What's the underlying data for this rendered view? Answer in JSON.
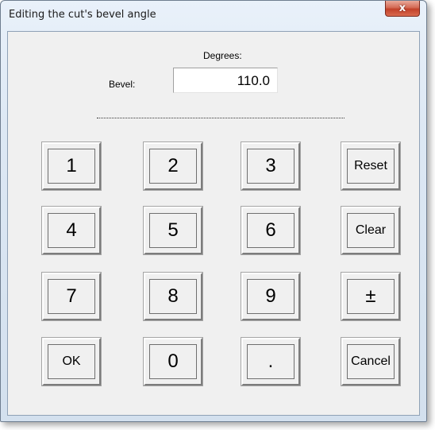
{
  "window": {
    "title": "Editing the cut's bevel angle",
    "close_glyph": "x"
  },
  "field": {
    "unit_label": "Degrees:",
    "label": "Bevel:",
    "value": "110.0"
  },
  "keys": {
    "k1": "1",
    "k2": "2",
    "k3": "3",
    "reset": "Reset",
    "k4": "4",
    "k5": "5",
    "k6": "6",
    "clear": "Clear",
    "k7": "7",
    "k8": "8",
    "k9": "9",
    "plusminus": "±",
    "ok": "OK",
    "k0": "0",
    "dot": ".",
    "cancel": "Cancel"
  },
  "icons": {
    "close": "close-icon"
  }
}
